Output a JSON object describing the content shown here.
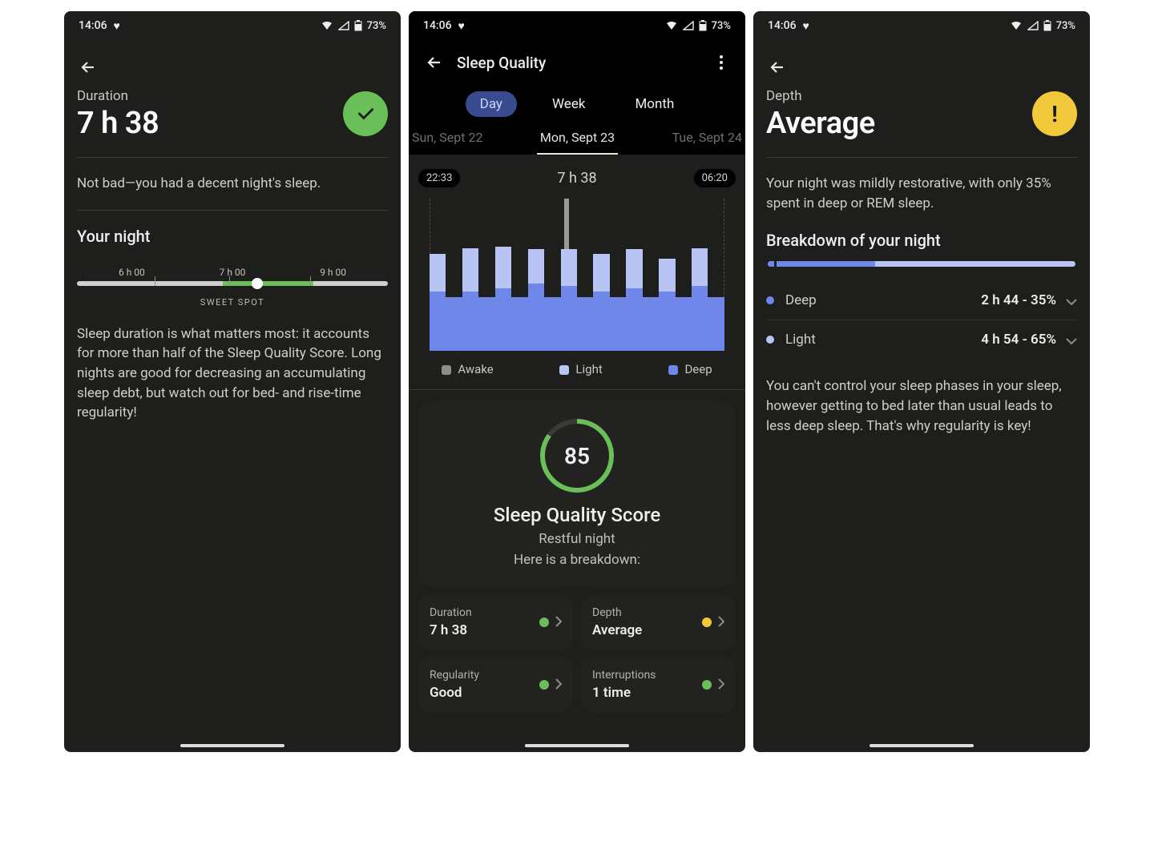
{
  "status": {
    "time": "14:06",
    "battery": "73%"
  },
  "colors": {
    "green": "#6bbf59",
    "yellow": "#f1c93b",
    "deep": "#6f87e8",
    "light": "#b8c4f3",
    "awake": "#8e8e89"
  },
  "screen1": {
    "title_sub": "Duration",
    "title_big": "7 h 38",
    "summary": "Not bad—you had a decent night's sleep.",
    "your_night": "Your night",
    "slider": {
      "labels": [
        "6 h 00",
        "7 h 00",
        "9 h 00"
      ],
      "sweet_spot": "SWEET SPOT",
      "value_pct": 58,
      "green_start_pct": 47,
      "green_end_pct": 76
    },
    "paragraph": "Sleep duration is what matters most: it accounts for more than half of the Sleep Quality Score. Long nights are good for decreasing an accumulating sleep debt, but watch out for bed- and rise-time regularity!"
  },
  "screen2": {
    "page_title": "Sleep Quality",
    "tabs": [
      "Day",
      "Week",
      "Month"
    ],
    "dates": {
      "prev": "Sun, Sept 22",
      "current": "Mon, Sept 23",
      "next": "Tue, Sept 24"
    },
    "bed_time": "22:33",
    "wake_time": "06:20",
    "total": "7 h 38",
    "legend": {
      "awake": "Awake",
      "light": "Light",
      "deep": "Deep"
    },
    "score": {
      "value": "85",
      "title": "Sleep Quality Score",
      "sub1": "Restful night",
      "sub2": "Here is a breakdown:"
    },
    "metrics": [
      {
        "label": "Duration",
        "value": "7 h 38",
        "dot": "green"
      },
      {
        "label": "Depth",
        "value": "Average",
        "dot": "yellow"
      },
      {
        "label": "Regularity",
        "value": "Good",
        "dot": "green"
      },
      {
        "label": "Interruptions",
        "value": "1 time",
        "dot": "green"
      }
    ]
  },
  "screen3": {
    "title_sub": "Depth",
    "title_big": "Average",
    "summary": "Your night was mildly restorative, with only 35% spent in deep or REM sleep.",
    "breakdown_title": "Breakdown of your night",
    "deep_pct": 35,
    "rows": [
      {
        "name": "Deep",
        "value": "2 h 44 - 35%",
        "color": "deep"
      },
      {
        "name": "Light",
        "value": "4 h 54 - 65%",
        "color": "light"
      }
    ],
    "footer": "You can't control your sleep phases in your sleep, however getting to bed later than usual leads to less deep sleep. That's why regularity is key!"
  },
  "chart_data": {
    "type": "bar",
    "title": "Sleep stages Mon, Sept 23",
    "x_start": "22:33",
    "x_end": "06:20",
    "series": [
      {
        "name": "Deep",
        "color": "#6f87e8"
      },
      {
        "name": "Light",
        "color": "#b8c4f3"
      },
      {
        "name": "Awake",
        "color": "#8e8e89"
      }
    ],
    "segments": [
      {
        "deep": 0.55,
        "light": 0.35
      },
      {
        "deep": 0.5,
        "light": 0.0
      },
      {
        "deep": 0.55,
        "light": 0.4
      },
      {
        "deep": 0.5,
        "light": 0.0
      },
      {
        "deep": 0.58,
        "light": 0.38
      },
      {
        "deep": 0.5,
        "light": 0.0
      },
      {
        "deep": 0.62,
        "light": 0.32
      },
      {
        "deep": 0.5,
        "light": 0.0
      },
      {
        "deep": 0.6,
        "light": 0.34
      },
      {
        "deep": 0.5,
        "light": 0.0
      },
      {
        "deep": 0.55,
        "light": 0.35
      },
      {
        "deep": 0.5,
        "light": 0.0
      },
      {
        "deep": 0.58,
        "light": 0.36
      },
      {
        "deep": 0.5,
        "light": 0.0
      },
      {
        "deep": 0.55,
        "light": 0.3
      },
      {
        "deep": 0.5,
        "light": 0.0
      },
      {
        "deep": 0.6,
        "light": 0.35
      },
      {
        "deep": 0.5,
        "light": 0.0
      }
    ],
    "note": "deep/light are fractions of stacked bar height; zero light = only deep block visible"
  }
}
